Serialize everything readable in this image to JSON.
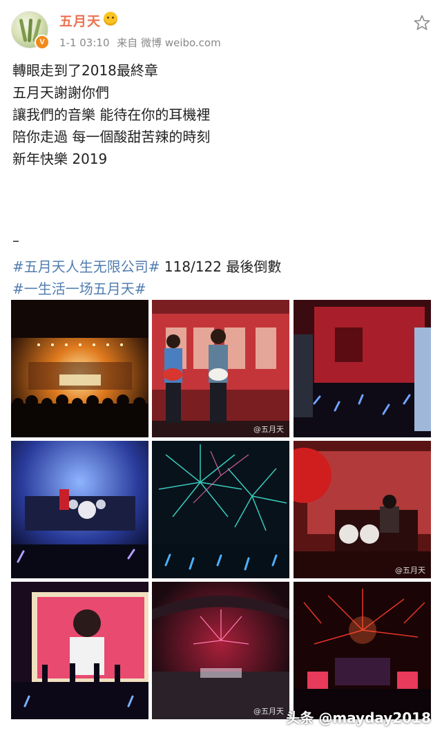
{
  "post": {
    "username": "五月天",
    "verified_badge": "V",
    "timestamp": "1-1 03:10",
    "source": "来自 微博 weibo.com",
    "lines": [
      "轉眼走到了2018最終章",
      "五月天謝謝你們",
      "讓我們的音樂 能待在你的耳機裡",
      "陪你走過 每一個酸甜苦辣的時刻",
      "新年快樂 2019"
    ],
    "dash": "–",
    "topic1": {
      "tag": "#五月天人生无限公司#",
      "rest": " 118/122 最後倒數"
    },
    "topic2": {
      "tag": "#一生活一场五月天#",
      "rest": ""
    },
    "icons": {
      "favorite": "star-outline-icon",
      "emoji": "smiling-face-icon"
    }
  },
  "images": [
    {
      "name": "photo-countdown-stage",
      "watermark": ""
    },
    {
      "name": "photo-guitarists",
      "watermark": "@五月天"
    },
    {
      "name": "photo-red-stage",
      "watermark": ""
    },
    {
      "name": "photo-blue-drums-stage",
      "watermark": ""
    },
    {
      "name": "photo-teal-fireworks",
      "watermark": ""
    },
    {
      "name": "photo-drummer",
      "watermark": "@五月天"
    },
    {
      "name": "photo-screen-singer",
      "watermark": ""
    },
    {
      "name": "photo-stadium-fireworks",
      "watermark": "@五月天"
    },
    {
      "name": "photo-red-fireworks",
      "watermark": ""
    }
  ],
  "footer": {
    "brand": "头条",
    "handle": " @mayday2018"
  },
  "colors": {
    "username": "#eb7350",
    "topic": "#507daf",
    "meta": "#888888"
  }
}
